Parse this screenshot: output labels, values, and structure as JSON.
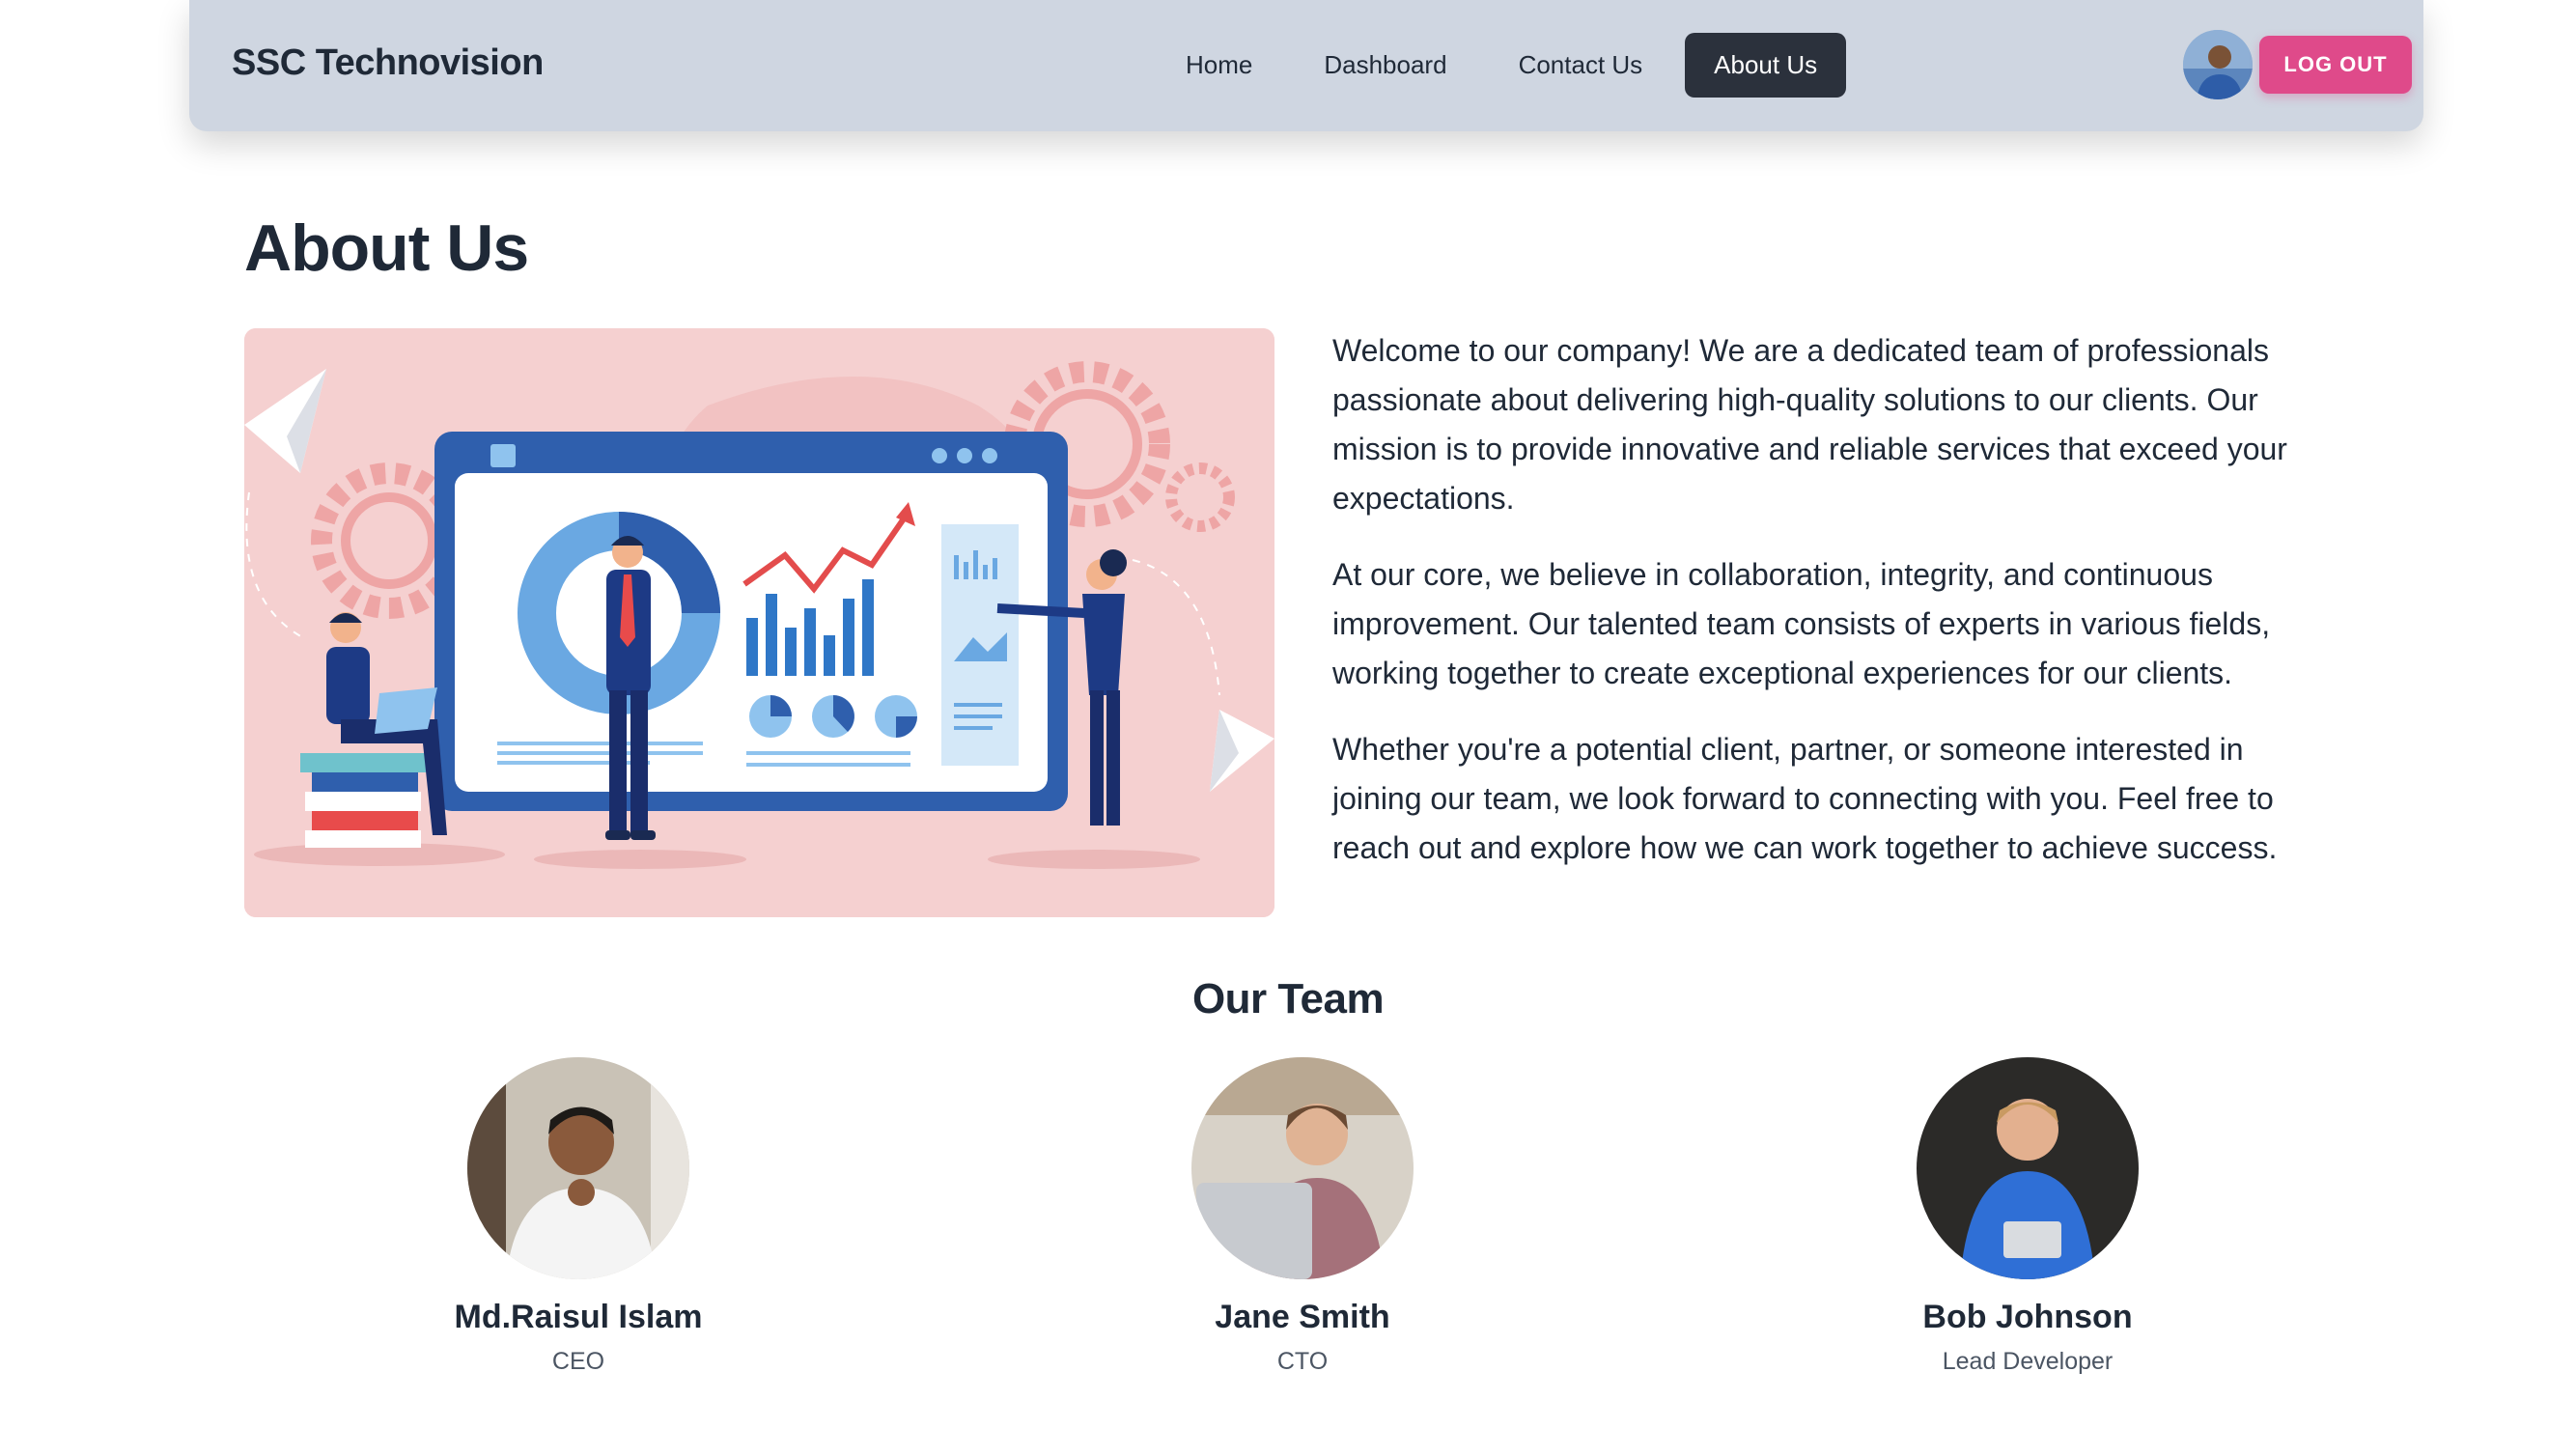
{
  "header": {
    "brand": "SSC Technovision",
    "nav": [
      {
        "label": "Home"
      },
      {
        "label": "Dashboard"
      },
      {
        "label": "Contact Us"
      },
      {
        "label": "About Us",
        "active": true
      }
    ],
    "logout_label": "LOG OUT"
  },
  "page": {
    "title": "About Us",
    "paragraphs": [
      "Welcome to our company! We are a dedicated team of professionals passionate about delivering high-quality solutions to our clients. Our mission is to provide innovative and reliable services that exceed your expectations.",
      "At our core, we believe in collaboration, integrity, and continuous improvement. Our talented team consists of experts in various fields, working together to create exceptional experiences for our clients.",
      "Whether you're a potential client, partner, or someone interested in joining our team, we look forward to connecting with you. Feel free to reach out and explore how we can work together to achieve success."
    ]
  },
  "team": {
    "title": "Our Team",
    "members": [
      {
        "name": "Md.Raisul Islam",
        "role": "CEO"
      },
      {
        "name": "Jane Smith",
        "role": "CTO"
      },
      {
        "name": "Bob Johnson",
        "role": "Lead Developer"
      }
    ]
  },
  "colors": {
    "navbar_bg": "#cfd6e1",
    "active_tab": "#2b313c",
    "logout_button": "#df4a8a",
    "hero_bg": "#f5d0d0",
    "illustration_blue": "#2f5fad"
  }
}
